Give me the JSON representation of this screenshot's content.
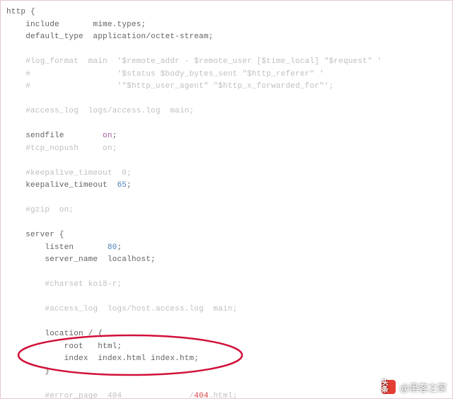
{
  "code": {
    "l01_a": "http {",
    "l02_a": "    include       ",
    "l02_b": "mime.types;",
    "l03_a": "    default_type  ",
    "l03_b": "application/octet-stream;",
    "l04": "",
    "l05": "    #log_format  main  '$remote_addr - $remote_user [$time_local] \"$request\" '",
    "l06": "    #                  '$status $body_bytes_sent \"$http_referer\" '",
    "l07": "    #                  '\"$http_user_agent\" \"$http_x_forwarded_for\"';",
    "l08": "",
    "l09": "    #access_log  logs/access.log  main;",
    "l10": "",
    "l11_a": "    sendfile        ",
    "l11_b": "on",
    "l11_c": ";",
    "l12": "    #tcp_nopush     on;",
    "l13": "",
    "l14": "    #keepalive_timeout  0;",
    "l15_a": "    keepalive_timeout  ",
    "l15_b": "65",
    "l15_c": ";",
    "l16": "",
    "l17": "    #gzip  on;",
    "l18": "",
    "l19_a": "    server {",
    "l20_a": "        listen       ",
    "l20_b": "80",
    "l20_c": ";",
    "l21_a": "        server_name  ",
    "l21_b": "localhost;",
    "l22": "",
    "l23": "        #charset koi8-r;",
    "l24": "",
    "l25": "        #access_log  logs/host.access.log  main;",
    "l26": "",
    "l27": "        location / {",
    "l28": "            root   html;",
    "l29": "            index  index.html index.htm;",
    "l30": "        }",
    "l31": "",
    "l32_a": "        #error_page  404              /",
    "l32_b": "404",
    "l32_c": ".html;"
  },
  "watermark": {
    "logo_text": "头条",
    "text": "@黑客之家"
  }
}
